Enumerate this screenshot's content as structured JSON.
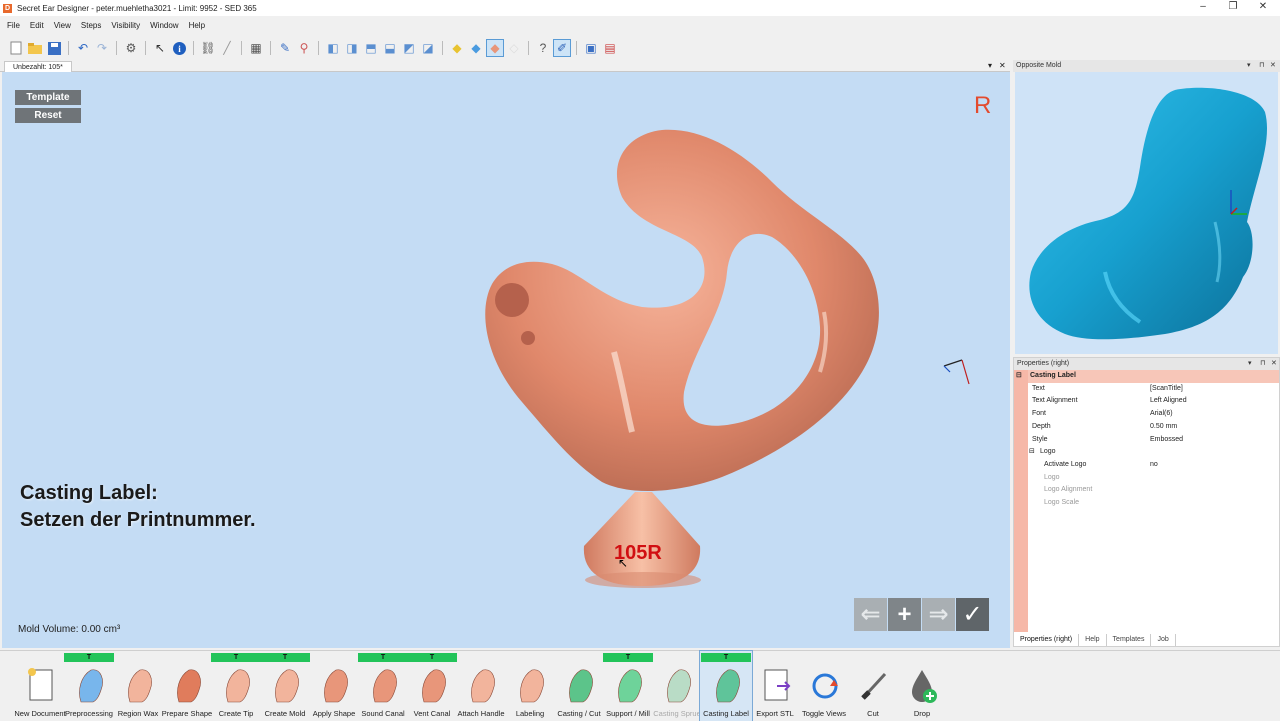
{
  "window": {
    "title": "Secret Ear Designer - peter.muehletha3021 - Limit: 9952 - SED 365"
  },
  "menu": [
    "File",
    "Edit",
    "View",
    "Steps",
    "Visibility",
    "Window",
    "Help"
  ],
  "document_tab": {
    "label": "Unbezahlt: 105*"
  },
  "viewport": {
    "template_button": "Template",
    "reset_button": "Reset",
    "side_indicator": "R",
    "caption_line1": "Casting Label:",
    "caption_line2": "Setzen der Printnummer.",
    "mold_volume": "Mold Volume: 0.00 cm³",
    "engraved_label": "105R"
  },
  "opposite_mold": {
    "title": "Opposite Mold"
  },
  "properties": {
    "title": "Properties (right)",
    "rows": [
      {
        "key": "Casting Label",
        "value": "",
        "type": "cat"
      },
      {
        "key": "Text",
        "value": "[ScanTitle]",
        "type": "row"
      },
      {
        "key": "Text Alignment",
        "value": "Left Aligned",
        "type": "row"
      },
      {
        "key": "Font",
        "value": "Arial(6)",
        "type": "row"
      },
      {
        "key": "Depth",
        "value": "0.50 mm",
        "type": "row"
      },
      {
        "key": "Style",
        "value": "Embossed",
        "type": "row"
      },
      {
        "key": "Logo",
        "value": "",
        "type": "sub"
      },
      {
        "key": "Activate Logo",
        "value": "no",
        "type": "row2"
      },
      {
        "key": "Logo",
        "value": "",
        "type": "grey"
      },
      {
        "key": "Logo Alignment",
        "value": "",
        "type": "grey"
      },
      {
        "key": "Logo Scale",
        "value": "",
        "type": "grey"
      }
    ],
    "tabs": [
      "Properties (right)",
      "Help",
      "Templates",
      "Job"
    ]
  },
  "steps": [
    {
      "label": "New Document",
      "t": false,
      "icon": "new-document-icon"
    },
    {
      "label": "Preprocessing",
      "t": true,
      "icon": "preprocessing-icon"
    },
    {
      "label": "Region Wax",
      "t": false,
      "icon": "region-wax-icon"
    },
    {
      "label": "Prepare Shape",
      "t": false,
      "icon": "prepare-shape-icon"
    },
    {
      "label": "Create Tip",
      "t": true,
      "icon": "create-tip-icon"
    },
    {
      "label": "Create Mold",
      "t": true,
      "icon": "create-mold-icon"
    },
    {
      "label": "Apply Shape",
      "t": false,
      "icon": "apply-shape-icon"
    },
    {
      "label": "Sound Canal",
      "t": true,
      "icon": "sound-canal-icon"
    },
    {
      "label": "Vent Canal",
      "t": true,
      "icon": "vent-canal-icon"
    },
    {
      "label": "Attach Handle",
      "t": false,
      "icon": "attach-handle-icon"
    },
    {
      "label": "Labeling",
      "t": false,
      "icon": "labeling-icon"
    },
    {
      "label": "Casting / Cut",
      "t": false,
      "icon": "casting-cut-icon"
    },
    {
      "label": "Support / Mill",
      "t": true,
      "icon": "support-mill-icon"
    },
    {
      "label": "Casting Sprue",
      "t": false,
      "icon": "casting-sprue-icon",
      "dim": true
    },
    {
      "label": "Casting Label",
      "t": true,
      "icon": "casting-label-icon",
      "active": true
    },
    {
      "label": "Export STL",
      "t": false,
      "icon": "export-stl-icon"
    },
    {
      "label": "Toggle Views",
      "t": false,
      "icon": "toggle-views-icon"
    },
    {
      "label": "Cut",
      "t": false,
      "icon": "cut-icon"
    },
    {
      "label": "Drop",
      "t": false,
      "icon": "drop-icon"
    }
  ],
  "t_marker": "T",
  "colors": {
    "mold": "#e7957a",
    "opposite": "#1aa7d4",
    "viewport_bg": "#c4dcf4",
    "accent": "#e34b2e"
  }
}
